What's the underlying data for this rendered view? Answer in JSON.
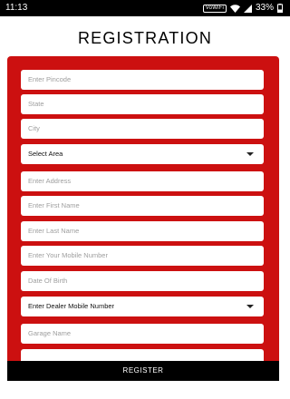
{
  "status_bar": {
    "time": "11:13",
    "vowifi": "VoWiFi",
    "battery": "33%"
  },
  "page": {
    "title": "REGISTRATION"
  },
  "form": {
    "pincode_placeholder": "Enter Pincode",
    "state_placeholder": "State",
    "city_placeholder": "City",
    "area_select": "Select Area",
    "address_placeholder": "Enter Address",
    "first_name_placeholder": "Enter First Name",
    "last_name_placeholder": "Enter Last Name",
    "mobile_placeholder": "Enter Your Mobile Number",
    "dob_placeholder": "Date Of Birth",
    "dealer_select": "Enter Dealer Mobile Number",
    "garage_placeholder": "Garage Name"
  },
  "actions": {
    "register_label": "REGISTER"
  }
}
